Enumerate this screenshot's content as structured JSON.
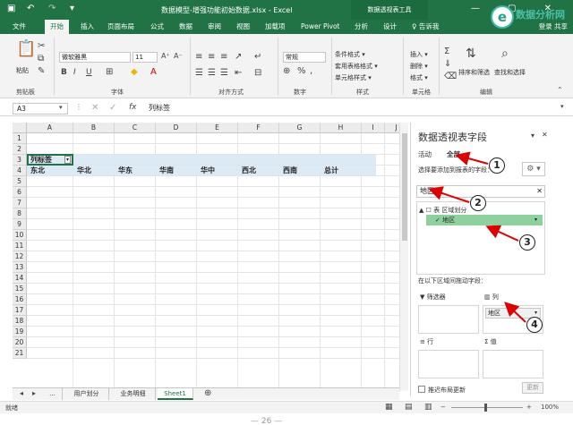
{
  "titlebar": {
    "title": "数据模型-增强功能初始数据.xlsx - Excel",
    "contextual_tool": "数据透视表工具",
    "window_controls": "— ▢ ✕"
  },
  "watermark": {
    "mark": "e",
    "text": "数据分析网"
  },
  "tabs": [
    {
      "label": "文件"
    },
    {
      "label": "开始"
    },
    {
      "label": "插入"
    },
    {
      "label": "页面布局"
    },
    {
      "label": "公式"
    },
    {
      "label": "数据"
    },
    {
      "label": "审阅"
    },
    {
      "label": "视图"
    },
    {
      "label": "加载项"
    },
    {
      "label": "Power Pivot"
    },
    {
      "label": "分析"
    },
    {
      "label": "设计"
    },
    {
      "label": "♀ 告诉我"
    }
  ],
  "share": "登录 共享",
  "ribbon": {
    "paste": "粘贴",
    "font_name": "微软雅黑",
    "font_size": "11",
    "number_format": "常规",
    "cond_format": "条件格式 ▾",
    "table_format": "套用表格格式 ▾",
    "cell_style": "单元格样式 ▾",
    "insert": "插入 ▾",
    "delete": "删除 ▾",
    "format": "格式 ▾",
    "sort_filter": "排序和筛选",
    "find_select": "查找和选择",
    "groups": [
      "剪贴板",
      "字体",
      "对齐方式",
      "数字",
      "样式",
      "单元格",
      "编辑"
    ]
  },
  "formula_bar": {
    "name_box": "A3",
    "value": "列标签"
  },
  "grid": {
    "columns": [
      "A",
      "B",
      "C",
      "D",
      "E",
      "F",
      "G",
      "H",
      "I",
      "J"
    ],
    "rows": [
      "1",
      "2",
      "3",
      "4",
      "5",
      "6",
      "7",
      "8",
      "9",
      "10",
      "11",
      "12",
      "13",
      "14",
      "15",
      "16",
      "17",
      "18",
      "19",
      "20",
      "21"
    ],
    "a3_label": "列标签",
    "row4": [
      "东北",
      "华北",
      "华东",
      "华南",
      "华中",
      "西北",
      "西南",
      "总计"
    ]
  },
  "sheets": [
    "...",
    "用户划分",
    "业务明细",
    "Sheet1"
  ],
  "status": {
    "ready": "就绪",
    "zoom": "100%"
  },
  "footer": "— 26 —",
  "pane": {
    "title": "数据透视表字段",
    "tab_active": "活动",
    "tab_all": "全部",
    "choose_label": "选择要添加到报表的字段：",
    "search_value": "地区",
    "table_node": "▲ ☐ 表 区域划分",
    "field": "✓ 地区",
    "drag_label": "在以下区域间拖动字段：",
    "zone_filter": "▼ 筛选器",
    "zone_columns": "▥ 列",
    "zone_rows": "≡ 行",
    "zone_values": "Σ 值",
    "column_item": "地区",
    "defer": "推迟布局更新",
    "update": "更新"
  },
  "callouts": [
    "1",
    "2",
    "3",
    "4"
  ],
  "colors": {
    "excel_green": "#217346",
    "field_highlight": "#8fd19e",
    "pivot_band": "#dceaf6"
  }
}
